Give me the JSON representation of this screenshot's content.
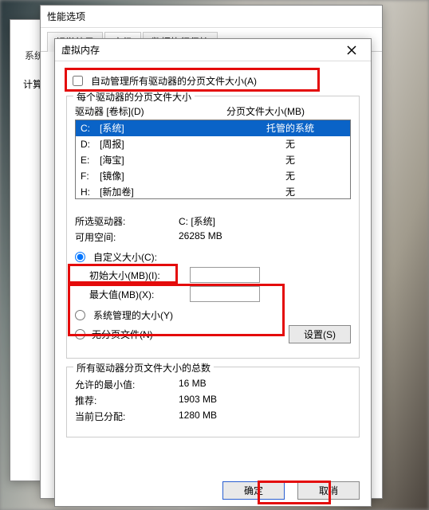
{
  "outer": {
    "title_fragment_sys": "系统",
    "title_fragment_calc": "计算",
    "perf_title": "性能选项",
    "tabs": [
      "视觉效果",
      "高级",
      "数据执行保护"
    ]
  },
  "vm": {
    "title": "虚拟内存",
    "auto_manage_label": "自动管理所有驱动器的分页文件大小(A)",
    "group_each_drive": "每个驱动器的分页文件大小",
    "col_drive": "驱动器 [卷标](D)",
    "col_pagefile": "分页文件大小(MB)",
    "drives": [
      {
        "letter": "C:",
        "vol": "[系统]",
        "size": "托管的系统",
        "selected": true
      },
      {
        "letter": "D:",
        "vol": "[周报]",
        "size": "无",
        "selected": false
      },
      {
        "letter": "E:",
        "vol": "[海宝]",
        "size": "无",
        "selected": false
      },
      {
        "letter": "F:",
        "vol": "[镜像]",
        "size": "无",
        "selected": false
      },
      {
        "letter": "H:",
        "vol": "[新加卷]",
        "size": "无",
        "selected": false
      }
    ],
    "selected_drive_label": "所选驱动器:",
    "selected_drive_value": "C:  [系统]",
    "free_space_label": "可用空间:",
    "free_space_value": "26285 MB",
    "radio_custom": "自定义大小(C):",
    "initial_label": "初始大小(MB)(I):",
    "initial_value": "",
    "max_label": "最大值(MB)(X):",
    "max_value": "",
    "radio_system": "系统管理的大小(Y)",
    "radio_none": "无分页文件(N)",
    "set_button": "设置(S)",
    "group_totals": "所有驱动器分页文件大小的总数",
    "min_label": "允许的最小值:",
    "min_value": "16 MB",
    "rec_label": "推荐:",
    "rec_value": "1903 MB",
    "cur_label": "当前已分配:",
    "cur_value": "1280 MB",
    "ok": "确定",
    "cancel": "取消"
  }
}
